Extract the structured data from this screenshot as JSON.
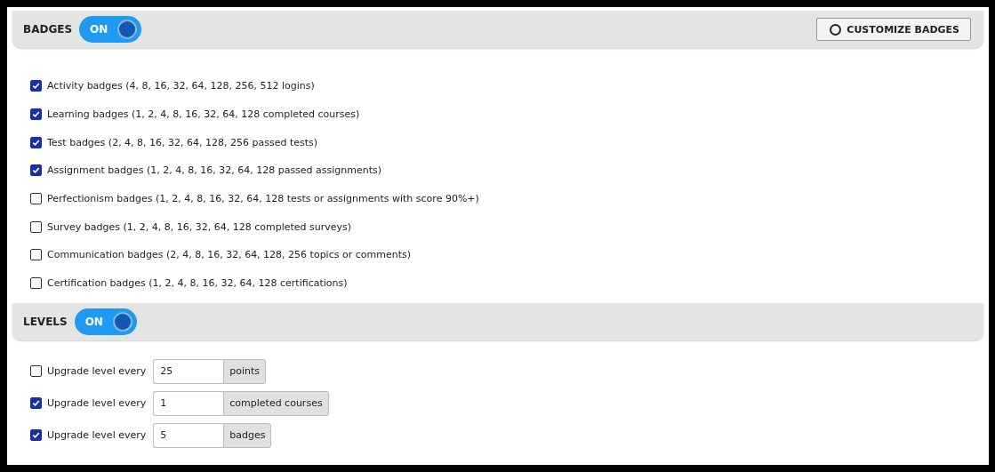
{
  "badges": {
    "title": "BADGES",
    "toggle": {
      "label": "ON",
      "on": true
    },
    "customize_button": "CUSTOMIZE BADGES",
    "items": [
      {
        "label": "Activity badges (4, 8, 16, 32, 64, 128, 256, 512 logins)",
        "checked": true
      },
      {
        "label": "Learning badges (1, 2, 4, 8, 16, 32, 64, 128 completed courses)",
        "checked": true
      },
      {
        "label": "Test badges (2, 4, 8, 16, 32, 64, 128, 256 passed tests)",
        "checked": true
      },
      {
        "label": "Assignment badges (1, 2, 4, 8, 16, 32, 64, 128 passed assignments)",
        "checked": true
      },
      {
        "label": "Perfectionism badges (1, 2, 4, 8, 16, 32, 64, 128 tests or assignments with score 90%+)",
        "checked": false
      },
      {
        "label": "Survey badges (1, 2, 4, 8, 16, 32, 64, 128 completed surveys)",
        "checked": false
      },
      {
        "label": "Communication badges (2, 4, 8, 16, 32, 64, 128, 256 topics or comments)",
        "checked": false
      },
      {
        "label": "Certification badges (1, 2, 4, 8, 16, 32, 64, 128 certifications)",
        "checked": false
      }
    ]
  },
  "levels": {
    "title": "LEVELS",
    "toggle": {
      "label": "ON",
      "on": true
    },
    "items": [
      {
        "label": "Upgrade level every",
        "checked": false,
        "value": "25",
        "unit": "points"
      },
      {
        "label": "Upgrade level every",
        "checked": true,
        "value": "1",
        "unit": "completed courses"
      },
      {
        "label": "Upgrade level every",
        "checked": true,
        "value": "5",
        "unit": "badges"
      }
    ]
  }
}
